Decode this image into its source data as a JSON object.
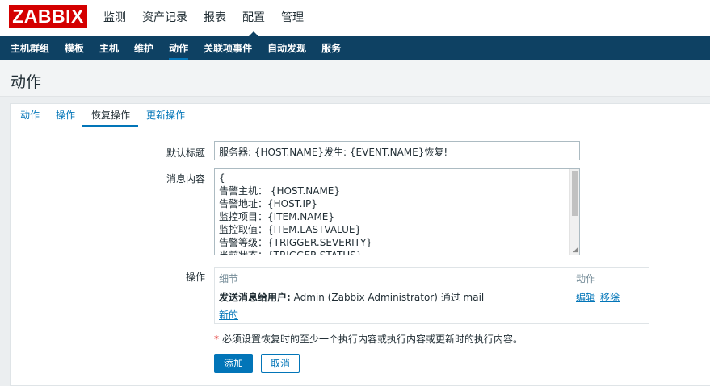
{
  "app": {
    "logo": "ZABBIX",
    "brand_color": "#d40000"
  },
  "main_menu": [
    {
      "label": "监测",
      "selected": false
    },
    {
      "label": "资产记录",
      "selected": false
    },
    {
      "label": "报表",
      "selected": false
    },
    {
      "label": "配置",
      "selected": true
    },
    {
      "label": "管理",
      "selected": false
    }
  ],
  "sub_menu": [
    {
      "label": "主机群组",
      "selected": false
    },
    {
      "label": "模板",
      "selected": false
    },
    {
      "label": "主机",
      "selected": false
    },
    {
      "label": "维护",
      "selected": false
    },
    {
      "label": "动作",
      "selected": true
    },
    {
      "label": "关联项事件",
      "selected": false
    },
    {
      "label": "自动发现",
      "selected": false
    },
    {
      "label": "服务",
      "selected": false
    }
  ],
  "page": {
    "title": "动作"
  },
  "tabs": [
    {
      "label": "动作",
      "active": false
    },
    {
      "label": "操作",
      "active": false
    },
    {
      "label": "恢复操作",
      "active": true
    },
    {
      "label": "更新操作",
      "active": false
    }
  ],
  "form": {
    "subject_label": "默认标题",
    "subject_value": "服务器: {HOST.NAME}发生: {EVENT.NAME}恢复!",
    "message_label": "消息内容",
    "message_lines": [
      "{",
      "告警主机：  {HOST.NAME}",
      "告警地址：{HOST.IP}",
      "监控项目：{ITEM.NAME}",
      "监控取值：{ITEM.LASTVALUE}",
      "告警等级：{TRIGGER.SEVERITY}",
      "当前状态：{TRIGGER.STATUS}"
    ],
    "operations_label": "操作",
    "operations": {
      "header_details": "细节",
      "header_action": "动作",
      "row_prefix": "发送消息给用户:",
      "row_text": " Admin (Zabbix Administrator) 通过 mail",
      "edit_label": "编辑",
      "remove_label": "移除",
      "new_label": "新的"
    },
    "note_star": "*",
    "note": "必须设置恢复时的至少一个执行内容或执行内容或更新时的执行内容。",
    "add_label": "添加",
    "cancel_label": "取消"
  },
  "colors": {
    "nav_bg": "#0e4163",
    "link": "#0275b8",
    "page_bg": "#ebeef0"
  }
}
